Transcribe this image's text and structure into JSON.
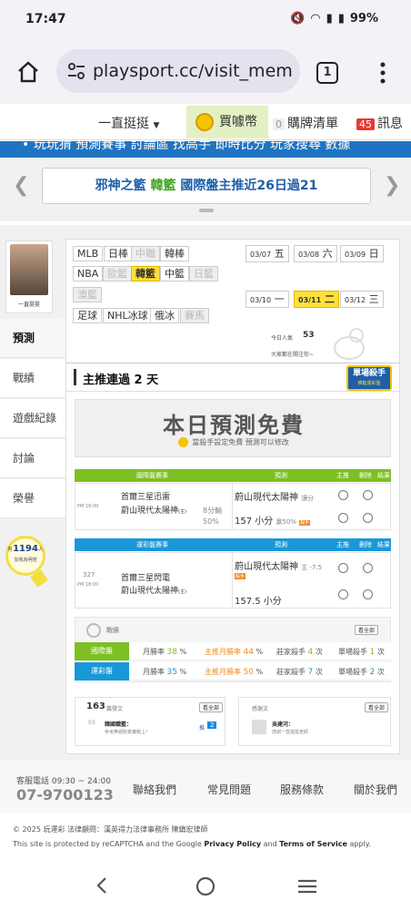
{
  "status_bar": {
    "time": "17:47",
    "battery": "99%"
  },
  "browser": {
    "url": "playsport.cc/visit_mem",
    "tab_count": "1"
  },
  "top_nav": {
    "dropdown": "一直挺挺",
    "buy": "買噱幣",
    "cart_count": "0",
    "cart": "購牌清單",
    "msg_count": "45",
    "msg": "訊息"
  },
  "blue_nav": "• 玩玩猜  預測賽事  討論區  找高手  即時比分  玩家搜尋  數據",
  "banner": {
    "prefix": "邪神之籃",
    "green": "韓籃",
    "suffix": "國際盤主推近26日過21"
  },
  "profile": {
    "name": "一直挺挺"
  },
  "side_tabs": [
    "預測",
    "戰績",
    "遊戲紀錄",
    "討論",
    "榮譽"
  ],
  "fans": {
    "count": "1194",
    "unit": "人",
    "label": "加我為明燈",
    "prefix": "有"
  },
  "leagues": {
    "row1": [
      {
        "label": "MLB",
        "state": ""
      },
      {
        "label": "日棒",
        "state": ""
      },
      {
        "label": "中職",
        "state": "dis"
      },
      {
        "label": "韓棒",
        "state": ""
      }
    ],
    "row2": [
      {
        "label": "NBA",
        "state": ""
      },
      {
        "label": "歐籃",
        "state": "dis"
      },
      {
        "label": "韓籃",
        "state": "on"
      },
      {
        "label": "中籃",
        "state": ""
      },
      {
        "label": "日籃",
        "state": "dis"
      }
    ],
    "row3": [
      {
        "label": "澳籃",
        "state": "dis"
      }
    ],
    "row4": [
      {
        "label": "足球",
        "state": ""
      },
      {
        "label": "NHL冰球",
        "state": ""
      },
      {
        "label": "俄冰",
        "state": ""
      },
      {
        "label": "賽馬",
        "state": "dis"
      }
    ]
  },
  "dates": {
    "row1": [
      {
        "d": "03/07",
        "w": "五",
        "on": false
      },
      {
        "d": "03/08",
        "w": "六",
        "on": false
      },
      {
        "d": "03/09",
        "w": "日",
        "on": false
      }
    ],
    "row2": [
      {
        "d": "03/10",
        "w": "一",
        "on": false
      },
      {
        "d": "03/11",
        "w": "二",
        "on": true
      },
      {
        "d": "03/12",
        "w": "三",
        "on": false
      }
    ]
  },
  "visits": {
    "label": "今日人氣",
    "count": "53",
    "note": "大家都在關注你~"
  },
  "streak": {
    "title": "主推連過 2 天",
    "badge": "單場殺手",
    "badge_sub": "韓籃運彩盤"
  },
  "free": {
    "title": "本日預測免費",
    "sub": "當殺手設定免費  預測可以修改"
  },
  "intl": {
    "header": {
      "game": "國際盤賽事",
      "pred": "預測",
      "main": "主推",
      "del": "刪除",
      "result": "結果"
    },
    "time": "PM 18:00",
    "team1": "首爾三星迅雷",
    "team2": "蔚山現代太陽神",
    "team2_tag": "(主)",
    "odds1": "8分輸",
    "odds2": "50%",
    "pick1": "蔚山現代太陽神",
    "pick1_tag": "讓分",
    "pick2": "157 小分",
    "pick2_tag": "贏50%",
    "pick2_icon": "殺手"
  },
  "sport": {
    "header": {
      "game": "運彩盤賽事",
      "pred": "預測",
      "main": "主推",
      "del": "刪除",
      "result": "結果"
    },
    "no": "327",
    "time": "PM 18:00",
    "team1": "首爾三星閃電",
    "team2": "蔚山現代太陽神",
    "team2_tag": "(主)",
    "pick1": "蔚山現代太陽神",
    "pick1_tag": "主 -7.5",
    "pick1_icon": "殺手",
    "pick2": "157.5 小分"
  },
  "record": {
    "title": "戰績",
    "all": "看全部",
    "intl": {
      "label": "國際盤",
      "month_l": "月勝率",
      "month": "38",
      "main_l": "主推月勝率",
      "main": "44",
      "line_l": "莊家殺手",
      "line": "4",
      "kill_l": "單場殺手",
      "kill": "1",
      "unit_pct": "%",
      "unit_n": "次"
    },
    "sport": {
      "label": "運彩盤",
      "month_l": "月勝率",
      "month": "35",
      "main_l": "主推月勝率",
      "main": "50",
      "line_l": "莊家殺手",
      "line": "7",
      "kill_l": "單場殺手",
      "kill": "2",
      "unit_pct": "%",
      "unit_n": "次"
    }
  },
  "posts": {
    "count": "163",
    "label": "篇發文",
    "all": "看全部",
    "item_num": "03",
    "item_title": "韓國職籃：",
    "item_sub": "參考無絕對真實戰上！",
    "item_badge_l": "推",
    "item_badge": "2"
  },
  "thanks": {
    "label": "感謝文",
    "all": "看全部",
    "item_title": "吳建河：",
    "item_sub": "感謝一直挺挺老師"
  },
  "footer": {
    "phone_label": "客服電話 09:30 ~ 24:00",
    "phone": "07-9700123",
    "links": [
      "聯絡我們",
      "常見問題",
      "服務條款",
      "關於我們"
    ]
  },
  "legal": {
    "line1": "© 2025 玩運彩 法律顧問：漢英得力法律事務所 陳鎮宏律師",
    "line2_a": "This site is protected by reCAPTCHA and the Google ",
    "line2_b": "Privacy Policy",
    "line2_c": " and ",
    "line2_d": "Terms of Service",
    "line2_e": " apply."
  },
  "colors": {
    "green": "#7dbf24",
    "blue": "#1998d8",
    "yellow": "#ffe03a",
    "brand_blue": "#1f74c2"
  }
}
